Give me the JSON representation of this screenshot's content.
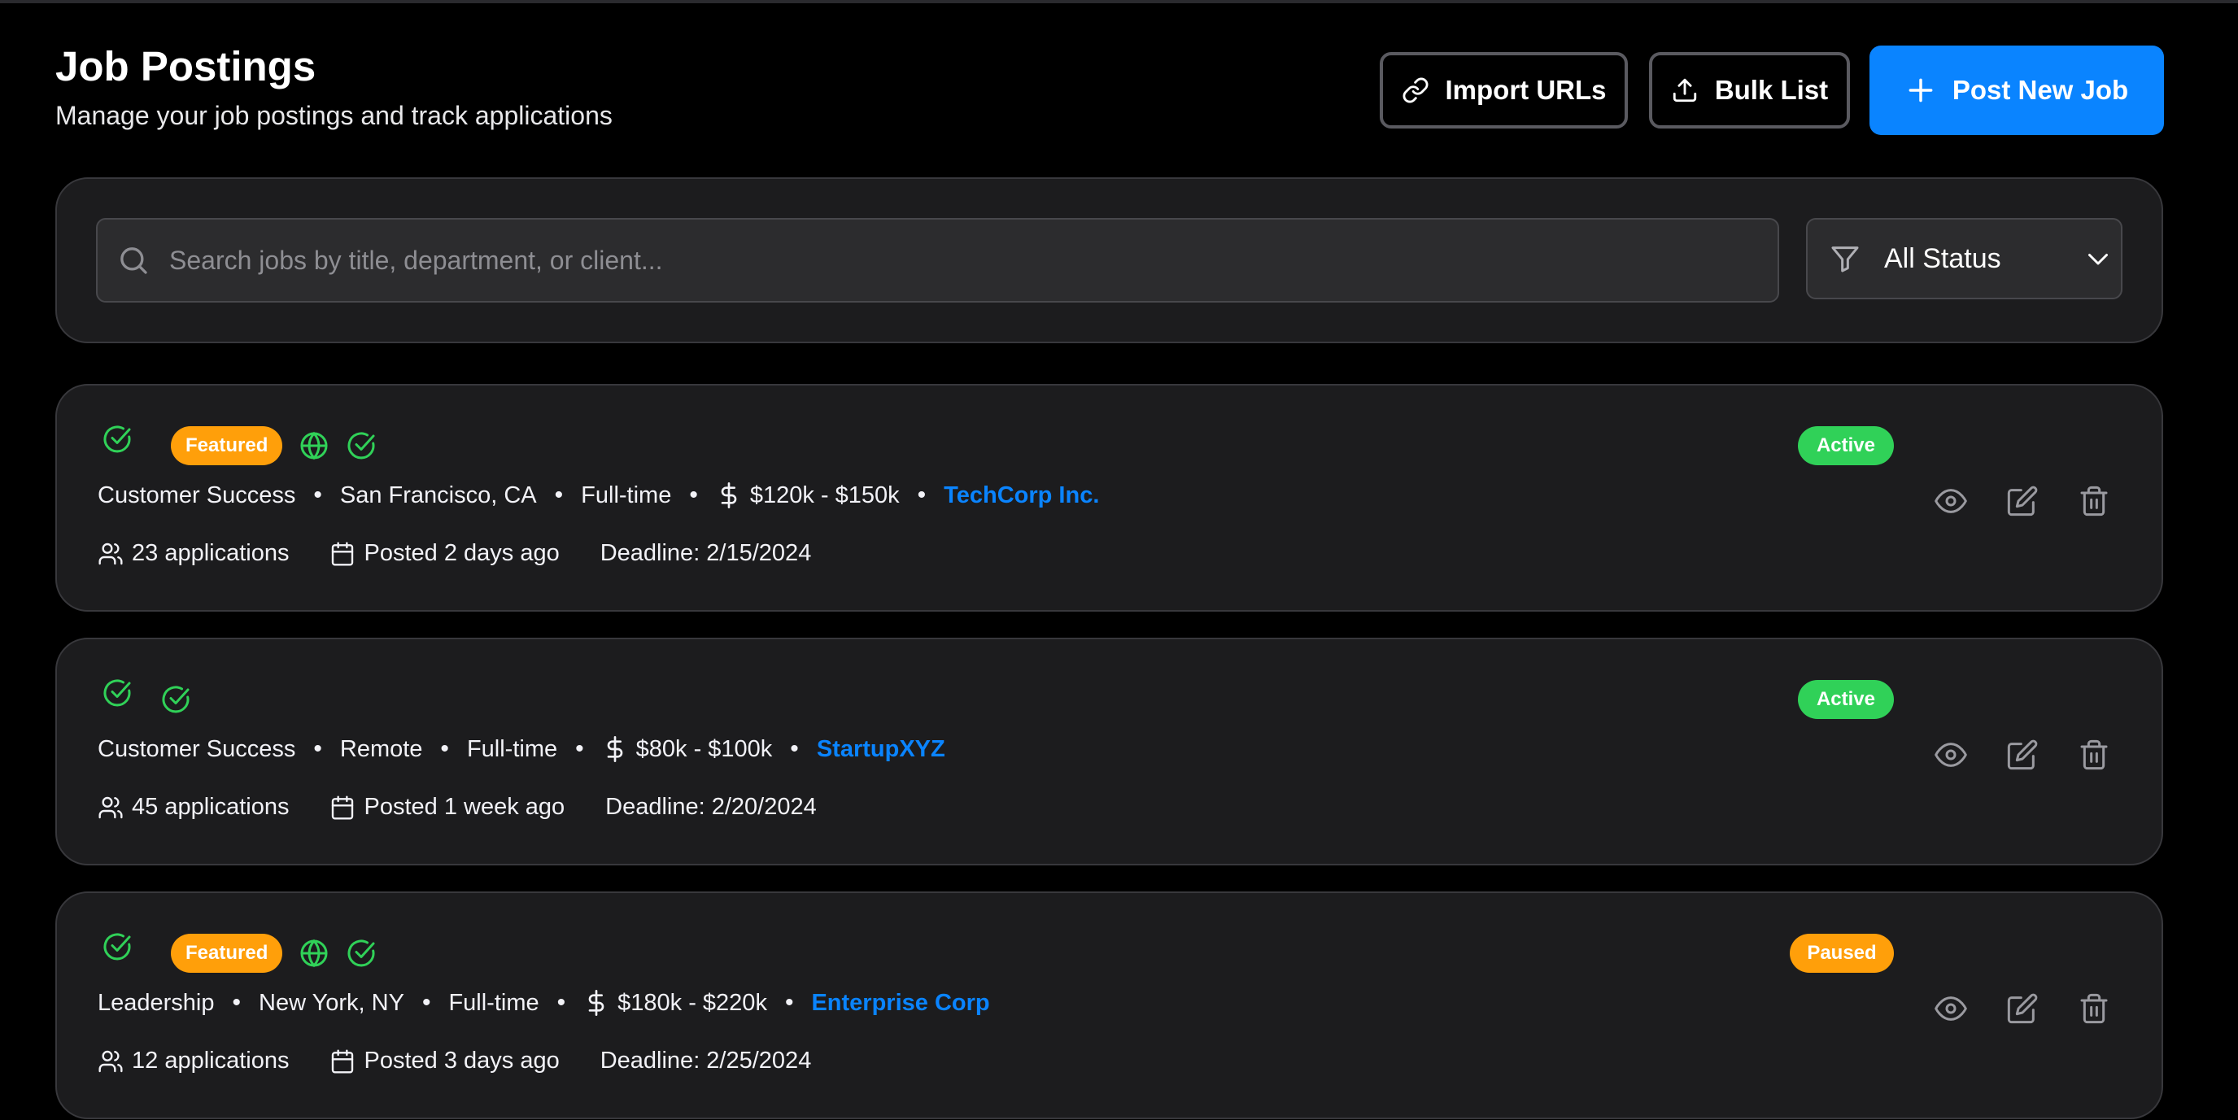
{
  "header": {
    "title": "Job Postings",
    "subtitle": "Manage your job postings and track applications"
  },
  "toolbar": {
    "import_label": "Import URLs",
    "bulk_label": "Bulk List",
    "post_label": "Post New Job"
  },
  "filters": {
    "search_placeholder": "Search jobs by title, department, or client...",
    "search_value": "",
    "status_selected": "All Status"
  },
  "colors": {
    "accent": "#0a84ff",
    "active": "#30d158",
    "paused": "#ff9f0a",
    "featured": "#ff9f0a",
    "check_icon": "#30d158"
  },
  "jobs": [
    {
      "featured": true,
      "featured_label": "Featured",
      "icons": [
        "check-circle-icon",
        "globe-icon",
        "check-circle-icon"
      ],
      "status": "Active",
      "department": "Customer Success",
      "location": "San Francisco, CA",
      "type": "Full-time",
      "salary": "$120k - $150k",
      "client": "TechCorp Inc.",
      "applications": "23 applications",
      "posted": "Posted 2 days ago",
      "deadline": "Deadline: 2/15/2024"
    },
    {
      "featured": false,
      "icons": [
        "check-circle-icon",
        "check-circle-icon"
      ],
      "status": "Active",
      "department": "Customer Success",
      "location": "Remote",
      "type": "Full-time",
      "salary": "$80k - $100k",
      "client": "StartupXYZ",
      "applications": "45 applications",
      "posted": "Posted 1 week ago",
      "deadline": "Deadline: 2/20/2024"
    },
    {
      "featured": true,
      "featured_label": "Featured",
      "icons": [
        "check-circle-icon",
        "globe-icon",
        "check-circle-icon"
      ],
      "status": "Paused",
      "department": "Leadership",
      "location": "New York, NY",
      "type": "Full-time",
      "salary": "$180k - $220k",
      "client": "Enterprise Corp",
      "applications": "12 applications",
      "posted": "Posted 3 days ago",
      "deadline": "Deadline: 2/25/2024"
    }
  ],
  "actions": [
    "eye-icon",
    "edit-icon",
    "trash-icon"
  ]
}
